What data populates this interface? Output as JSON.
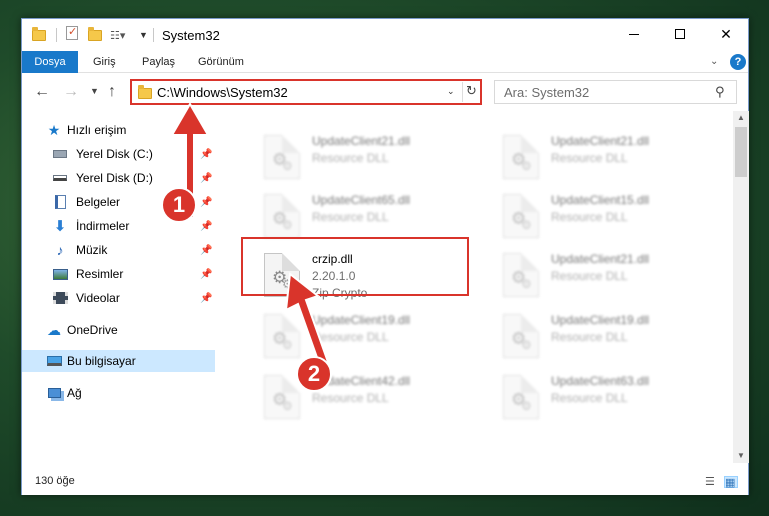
{
  "window": {
    "title": "System32"
  },
  "ribbon": {
    "tabs": [
      "Dosya",
      "Giriş",
      "Paylaş",
      "Görünüm"
    ],
    "help_label": "?"
  },
  "address": {
    "path": "C:\\Windows\\System32",
    "search_placeholder": "Ara: System32"
  },
  "nav": {
    "items": [
      {
        "label": "Hızlı erişim",
        "icon": "star-icon"
      },
      {
        "label": "Yerel Disk (C:)",
        "icon": "drive-icon",
        "pinned": true
      },
      {
        "label": "Yerel Disk (D:)",
        "icon": "drive-icon",
        "pinned": true
      },
      {
        "label": "Belgeler",
        "icon": "documents-icon",
        "pinned": true
      },
      {
        "label": "İndirmeler",
        "icon": "download-icon",
        "pinned": true
      },
      {
        "label": "Müzik",
        "icon": "music-icon",
        "pinned": true
      },
      {
        "label": "Resimler",
        "icon": "pictures-icon",
        "pinned": true
      },
      {
        "label": "Videolar",
        "icon": "video-icon",
        "pinned": true
      },
      {
        "label": "OneDrive",
        "icon": "cloud-icon"
      },
      {
        "label": "Bu bilgisayar",
        "icon": "computer-icon",
        "selected": true
      },
      {
        "label": "Ağ",
        "icon": "network-icon"
      }
    ]
  },
  "files": [
    {
      "name": "UpdateClient21.dll",
      "desc": "Resource DLL",
      "blurred": true
    },
    {
      "name": "UpdateClient21.dll",
      "desc": "Resource DLL",
      "blurred": true
    },
    {
      "name": "UpdateClient65.dll",
      "desc": "Resource DLL",
      "blurred": true
    },
    {
      "name": "UpdateClient15.dll",
      "desc": "Resource DLL",
      "blurred": true
    },
    {
      "name": "crzip.dll",
      "version": "2.20.1.0",
      "desc": "Zip Crypto",
      "blurred": false
    },
    {
      "name": "UpdateClient21.dll",
      "desc": "Resource DLL",
      "blurred": true
    },
    {
      "name": "UpdateClient19.dll",
      "desc": "Resource DLL",
      "blurred": true
    },
    {
      "name": "UpdateClient19.dll",
      "desc": "Resource DLL",
      "blurred": true
    },
    {
      "name": "UpdateClient42.dll",
      "desc": "Resource DLL",
      "blurred": true
    },
    {
      "name": "UpdateClient63.dll",
      "desc": "Resource DLL",
      "blurred": true
    }
  ],
  "status": {
    "item_count": "130 öğe"
  },
  "callouts": [
    "1",
    "2"
  ],
  "colors": {
    "accent": "#1979ca",
    "highlight": "#d9342b",
    "selection": "#cce8ff"
  }
}
